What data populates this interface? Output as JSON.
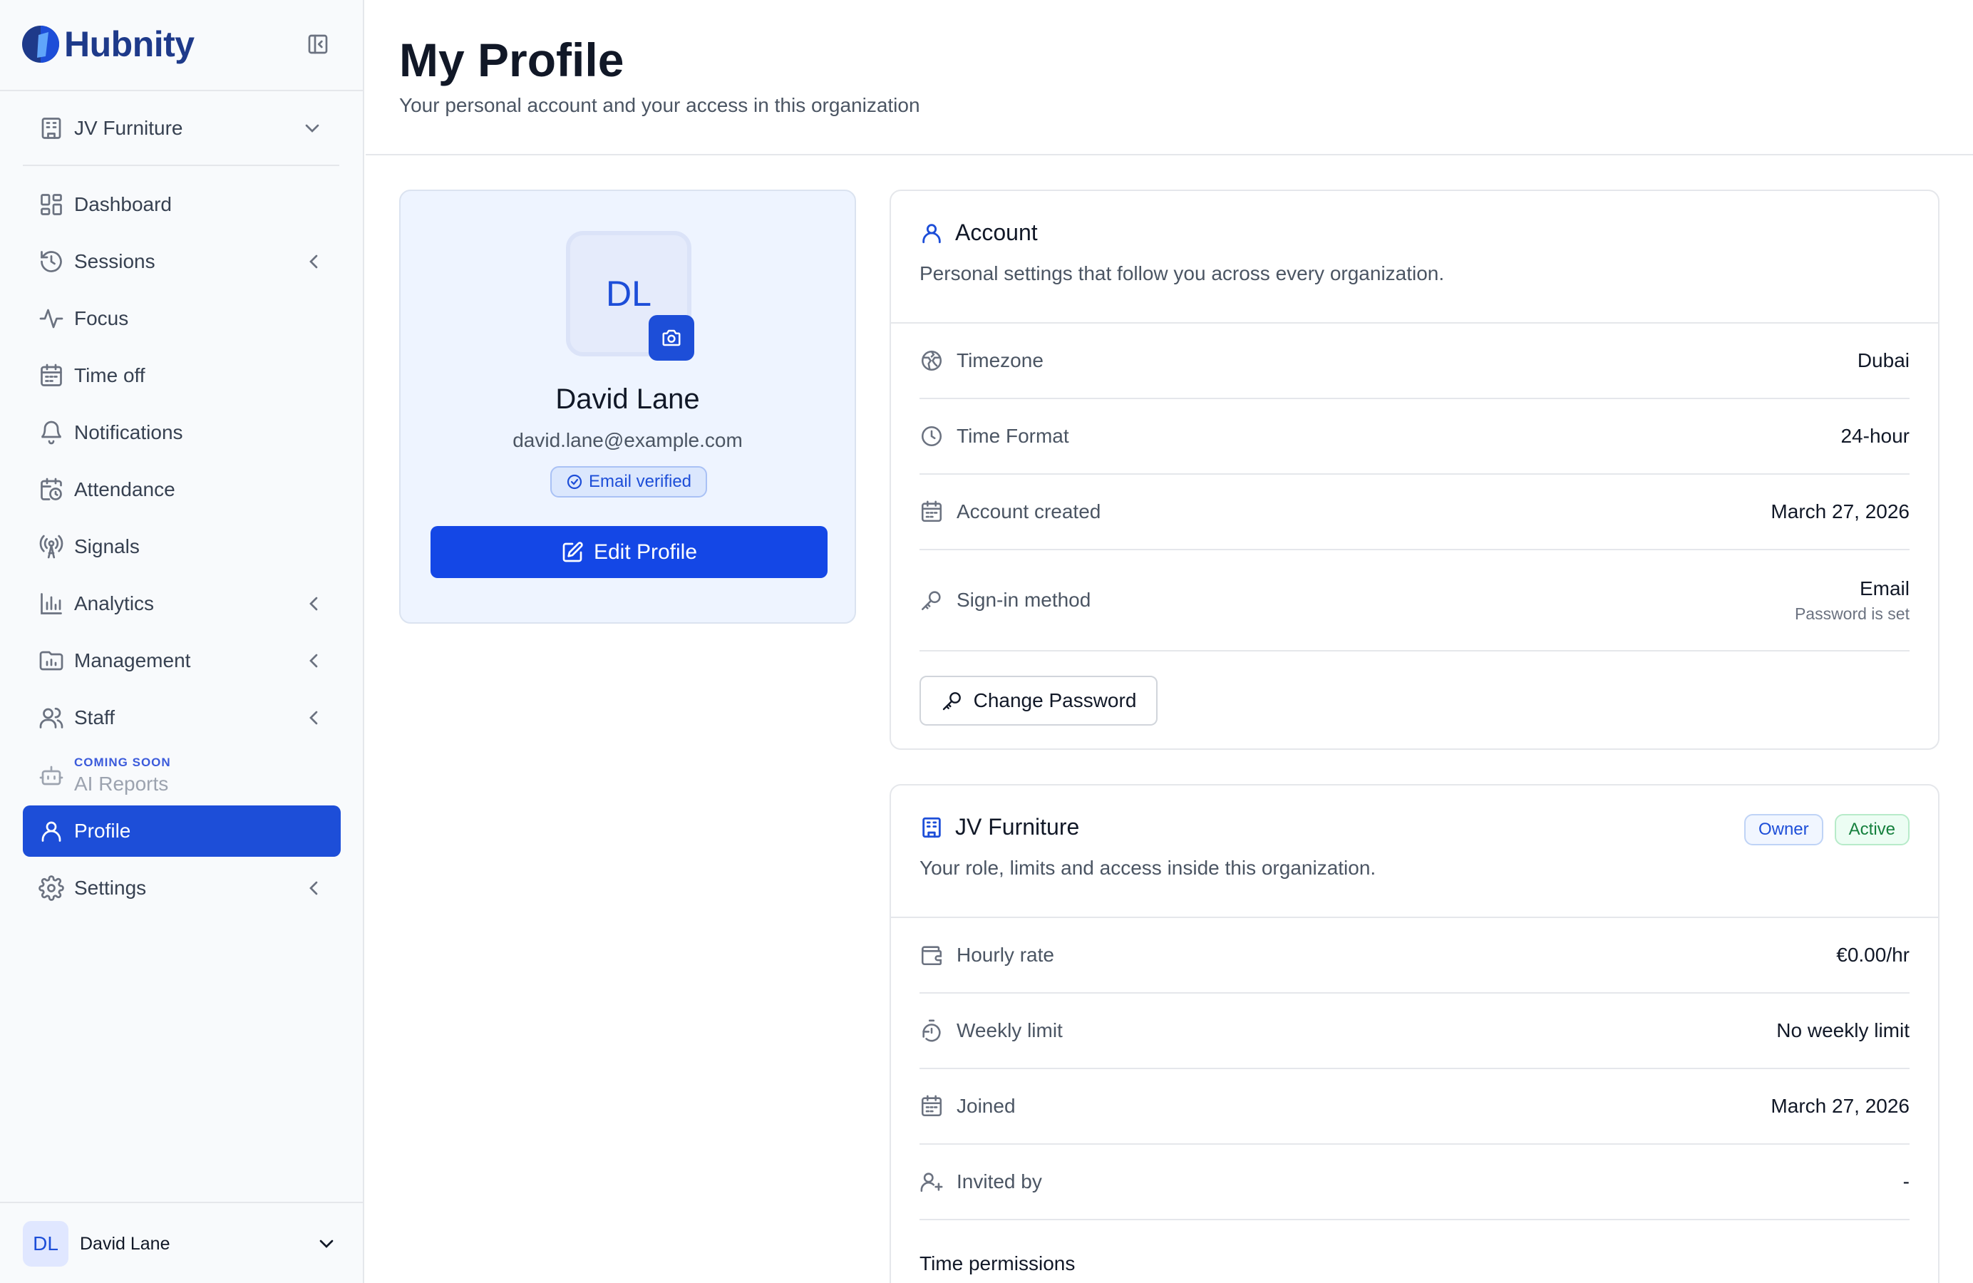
{
  "brand": {
    "name": "Hubnity"
  },
  "org_switcher": {
    "label": "JV Furniture"
  },
  "nav": [
    {
      "id": "dashboard",
      "label": "Dashboard",
      "icon": "dashboard-icon",
      "expandable": false
    },
    {
      "id": "sessions",
      "label": "Sessions",
      "icon": "history-icon",
      "expandable": true
    },
    {
      "id": "focus",
      "label": "Focus",
      "icon": "activity-icon",
      "expandable": false
    },
    {
      "id": "timeoff",
      "label": "Time off",
      "icon": "calendar-icon",
      "expandable": false
    },
    {
      "id": "notifications",
      "label": "Notifications",
      "icon": "bell-icon",
      "expandable": false
    },
    {
      "id": "attendance",
      "label": "Attendance",
      "icon": "calendar-clock-icon",
      "expandable": false
    },
    {
      "id": "signals",
      "label": "Signals",
      "icon": "radio-tower-icon",
      "expandable": false
    },
    {
      "id": "analytics",
      "label": "Analytics",
      "icon": "bar-chart-icon",
      "expandable": true
    },
    {
      "id": "management",
      "label": "Management",
      "icon": "folder-chart-icon",
      "expandable": true
    },
    {
      "id": "staff",
      "label": "Staff",
      "icon": "users-icon",
      "expandable": true
    },
    {
      "id": "ai_reports",
      "label": "AI Reports",
      "tag": "COMING SOON",
      "icon": "bot-icon",
      "expandable": false,
      "disabled": true
    },
    {
      "id": "profile",
      "label": "Profile",
      "icon": "user-icon",
      "expandable": false,
      "active": true
    },
    {
      "id": "settings",
      "label": "Settings",
      "icon": "gear-icon",
      "expandable": true
    }
  ],
  "sidebar_user": {
    "initials": "DL",
    "name": "David Lane"
  },
  "header": {
    "title": "My Profile",
    "subtitle": "Your personal account and your access in this organization"
  },
  "profile_card": {
    "initials": "DL",
    "name": "David Lane",
    "email": "david.lane@example.com",
    "verified_label": "Email verified",
    "edit_label": "Edit Profile"
  },
  "account": {
    "title": "Account",
    "description": "Personal settings that follow you across every organization.",
    "rows": [
      {
        "label": "Timezone",
        "value": "Dubai",
        "icon": "globe-icon"
      },
      {
        "label": "Time Format",
        "value": "24-hour",
        "icon": "clock-icon"
      },
      {
        "label": "Account created",
        "value": "March 27, 2026",
        "icon": "calendar-icon"
      },
      {
        "label": "Sign-in method",
        "value": "Email",
        "subvalue": "Password is set",
        "icon": "key-icon"
      }
    ],
    "change_password_label": "Change Password"
  },
  "organization": {
    "title": "JV Furniture",
    "description": "Your role, limits and access inside this organization.",
    "badges": [
      "Owner",
      "Active"
    ],
    "rows": [
      {
        "label": "Hourly rate",
        "value": "€0.00/hr",
        "icon": "wallet-icon"
      },
      {
        "label": "Weekly limit",
        "value": "No weekly limit",
        "icon": "timer-reset-icon"
      },
      {
        "label": "Joined",
        "value": "March 27, 2026",
        "icon": "calendar-icon"
      },
      {
        "label": "Invited by",
        "value": "-",
        "icon": "user-plus-icon"
      }
    ],
    "time_permissions_label": "Time permissions"
  },
  "colors": {
    "primary": "#1d4ed8",
    "brand_text": "#1e3a8a",
    "sidebar_bg": "#f8fafc",
    "profile_card_bg": "#eef4ff",
    "active_badge": "#15803d"
  }
}
